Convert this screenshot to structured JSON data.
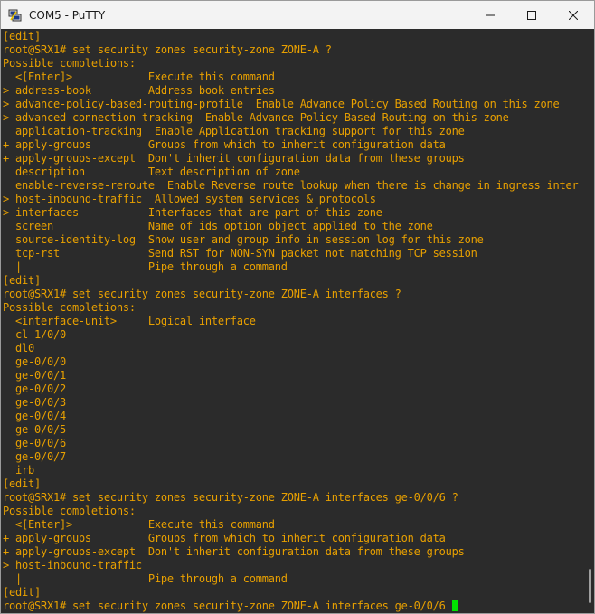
{
  "window": {
    "title": "COM5 - PuTTY",
    "app_icon": "putty-computer-icon",
    "controls": [
      "minimize-icon",
      "maximize-icon",
      "close-icon"
    ]
  },
  "colors": {
    "terminal_bg": "#2b2b2b",
    "text": "#e8a000",
    "cursor": "#00e400"
  },
  "terminal": {
    "lines": [
      "[edit]",
      "root@SRX1# set security zones security-zone ZONE-A ?",
      "Possible completions:",
      "  <[Enter]>            Execute this command",
      "> address-book         Address book entries",
      "> advance-policy-based-routing-profile  Enable Advance Policy Based Routing on this zone",
      "> advanced-connection-tracking  Enable Advance Policy Based Routing on this zone",
      "  application-tracking  Enable Application tracking support for this zone",
      "+ apply-groups         Groups from which to inherit configuration data",
      "+ apply-groups-except  Don't inherit configuration data from these groups",
      "  description          Text description of zone",
      "  enable-reverse-reroute  Enable Reverse route lookup when there is change in ingress inter",
      "> host-inbound-traffic  Allowed system services & protocols",
      "> interfaces           Interfaces that are part of this zone",
      "  screen               Name of ids option object applied to the zone",
      "  source-identity-log  Show user and group info in session log for this zone",
      "  tcp-rst              Send RST for NON-SYN packet not matching TCP session",
      "  |                    Pipe through a command",
      "[edit]",
      "root@SRX1# set security zones security-zone ZONE-A interfaces ?",
      "Possible completions:",
      "  <interface-unit>     Logical interface",
      "  cl-1/0/0",
      "  dl0",
      "  ge-0/0/0",
      "  ge-0/0/1",
      "  ge-0/0/2",
      "  ge-0/0/3",
      "  ge-0/0/4",
      "  ge-0/0/5",
      "  ge-0/0/6",
      "  ge-0/0/7",
      "  irb",
      "[edit]",
      "root@SRX1# set security zones security-zone ZONE-A interfaces ge-0/0/6 ?",
      "Possible completions:",
      "  <[Enter]>            Execute this command",
      "+ apply-groups         Groups from which to inherit configuration data",
      "+ apply-groups-except  Don't inherit configuration data from these groups",
      "> host-inbound-traffic",
      "  |                    Pipe through a command",
      "[edit]"
    ],
    "prompt_line": "root@SRX1# set security zones security-zone ZONE-A interfaces ge-0/0/6 "
  }
}
